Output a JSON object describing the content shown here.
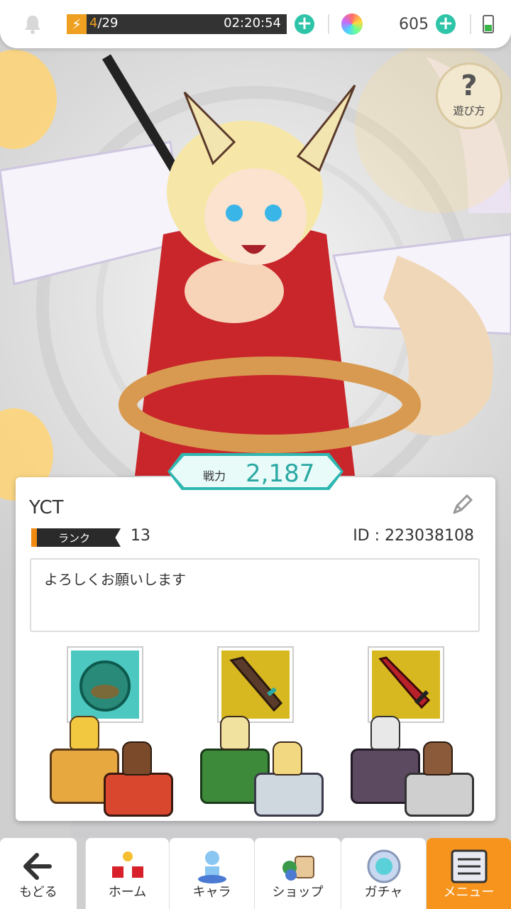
{
  "status_bar": {
    "stamina_current": "4",
    "stamina_max": "/29",
    "stamina_timer": "02:20:54",
    "gem_count": "605"
  },
  "help_button": {
    "icon": "?",
    "label": "遊び方"
  },
  "power": {
    "label": "戦力",
    "value": "2,187"
  },
  "profile": {
    "name": "YCT",
    "rank_label": "ランク",
    "rank_value": "13",
    "id": "ID : 223038108",
    "comment": "よろしくお願いします"
  },
  "party": [
    {
      "weapon": "orb-weapon",
      "weapon_bg": "#4cc8c0",
      "pedestal_main": "#e8a840",
      "pedestal_sub": "#d9482e"
    },
    {
      "weapon": "dark-blade-weapon",
      "weapon_bg": "#d8b820",
      "pedestal_main": "#3d8a3a",
      "pedestal_sub": "#cfd7df"
    },
    {
      "weapon": "red-sword-weapon",
      "weapon_bg": "#d8b820",
      "pedestal_main": "#5c4a60",
      "pedestal_sub": "#cfcfcf"
    }
  ],
  "nav": {
    "back": "もどる",
    "home": "ホーム",
    "chara": "キャラ",
    "shop": "ショップ",
    "gacha": "ガチャ",
    "menu": "メニュー"
  },
  "colors": {
    "accent": "#2ec4a8",
    "menu_active": "#f7941d",
    "rank_bar": "#f08a10"
  }
}
